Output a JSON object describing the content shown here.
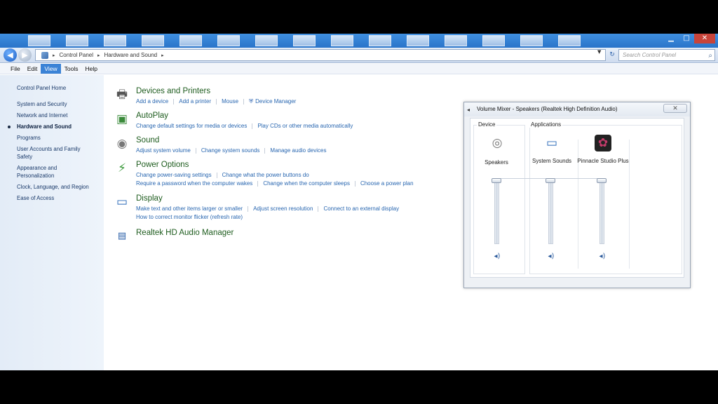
{
  "address": {
    "crumbs": [
      "Control Panel",
      "Hardware and Sound"
    ],
    "search_placeholder": "Search Control Panel"
  },
  "menu": [
    "File",
    "Edit",
    "View",
    "Tools",
    "Help"
  ],
  "sidebar": {
    "items": [
      "Control Panel Home",
      "System and Security",
      "Network and Internet",
      "Hardware and Sound",
      "Programs",
      "User Accounts and Family Safety",
      "Appearance and Personalization",
      "Clock, Language, and Region",
      "Ease of Access"
    ]
  },
  "categories": [
    {
      "title": "Devices and Printers",
      "icon": "printer-icon",
      "lines": [
        [
          "Add a device",
          "Add a printer",
          "Mouse",
          "Device Manager"
        ]
      ]
    },
    {
      "title": "AutoPlay",
      "icon": "autoplay-icon",
      "lines": [
        [
          "Change default settings for media or devices",
          "Play CDs or other media automatically"
        ]
      ]
    },
    {
      "title": "Sound",
      "icon": "speaker-icon",
      "lines": [
        [
          "Adjust system volume",
          "Change system sounds",
          "Manage audio devices"
        ]
      ]
    },
    {
      "title": "Power Options",
      "icon": "power-icon",
      "lines": [
        [
          "Change power-saving settings",
          "Change what the power buttons do"
        ],
        [
          "Require a password when the computer wakes",
          "Change when the computer sleeps",
          "Choose a power plan"
        ]
      ]
    },
    {
      "title": "Display",
      "icon": "monitor-icon",
      "lines": [
        [
          "Make text and other items larger or smaller",
          "Adjust screen resolution",
          "Connect to an external display"
        ],
        [
          "How to correct monitor flicker (refresh rate)"
        ]
      ]
    },
    {
      "title": "Realtek HD Audio Manager",
      "icon": "realtek-icon",
      "lines": []
    }
  ],
  "mixer": {
    "title": "Volume Mixer - Speakers (Realtek High Definition Audio)",
    "device_label": "Device",
    "applications_label": "Applications",
    "channels": [
      {
        "label": "Speakers",
        "icon": "speaker-device-icon",
        "level": 1.0
      },
      {
        "label": "System Sounds",
        "icon": "system-sounds-icon",
        "level": 1.0
      },
      {
        "label": "Pinnacle Studio Plus",
        "icon": "pinnacle-icon",
        "level": 1.0
      }
    ]
  }
}
